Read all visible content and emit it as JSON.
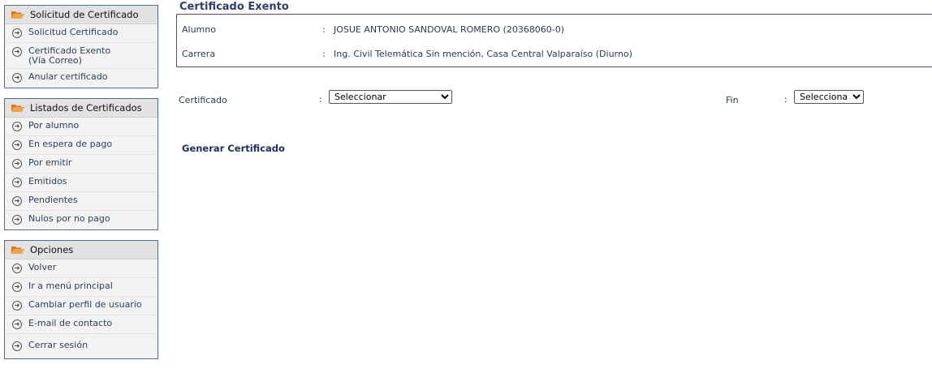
{
  "sidebar": {
    "sections": [
      {
        "title": "Solicitud de Certificado",
        "items": [
          "Solicitud Certificado",
          "Certificado Exento\n(Vía Correo)",
          "Anular certificado"
        ]
      },
      {
        "title": "Listados de Certificados",
        "items": [
          "Por alumno",
          "En espera de pago",
          "Por emitir",
          "Emitidos",
          "Pendientes",
          "Nulos por no pago"
        ]
      },
      {
        "title": "Opciones",
        "items": [
          "Volver",
          "Ir a menú principal",
          "Cambiar perfil de usuario",
          "E-mail de contacto",
          "Cerrar sesión"
        ]
      }
    ]
  },
  "main": {
    "title": "Certificado Exento",
    "info": {
      "alumno_label": "Alumno",
      "alumno_value": "JOSUE ANTONIO SANDOVAL ROMERO (20368060-0)",
      "carrera_label": "Carrera",
      "carrera_value": "Ing. Civil Telemática Sin mención, Casa Central Valparaíso (Diurno)",
      "colon": ":"
    },
    "form": {
      "certificado_label": "Certificado",
      "certificado_selected": "Seleccionar",
      "fin_label": "Fin",
      "fin_selected": "Seleccionar",
      "colon": ":"
    },
    "generate_label": "Generar Certificado"
  },
  "colors": {
    "accent": "#333a6e",
    "folder": "#f08a24",
    "border": "#4a5570"
  }
}
